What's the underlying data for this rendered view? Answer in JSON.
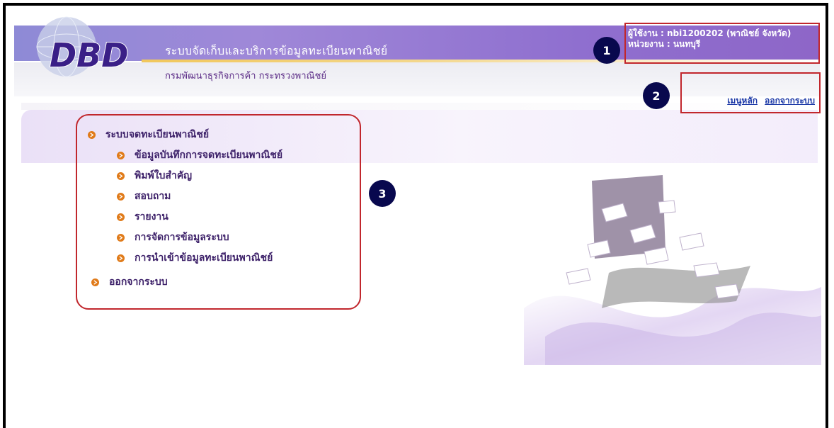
{
  "header": {
    "logo_text": "DBD",
    "system_title": "ระบบจัดเก็บและบริการข้อมูลทะเบียนพาณิชย์",
    "department": "กรมพัฒนาธุรกิจการค้า  กระทรวงพาณิชย์"
  },
  "user": {
    "user_line": "ผู้ใช้งาน : nbi1200202 (พาณิชย์ จังหวัด)",
    "unit_line": "หน่วยงาน : นนทบุรี"
  },
  "nav": {
    "main_menu": "เมนูหลัก",
    "logout": "ออกจากระบบ"
  },
  "badges": {
    "b1": "1",
    "b2": "2",
    "b3": "3"
  },
  "menu": {
    "registration": "ระบบจดทะเบียนพาณิชย์",
    "items": [
      "ข้อมูลบันทึกการจดทะเบียนพาณิชย์",
      "พิมพ์ใบสำคัญ",
      "สอบถาม",
      "รายงาน",
      "การจัดการข้อมูลระบบ",
      "การนำเข้าข้อมูลทะเบียนพาณิชย์"
    ],
    "logout": "ออกจากระบบ"
  },
  "colors": {
    "banner": "#8f7ad4",
    "highlight_box": "#c1272d",
    "badge": "#08084e",
    "menu_text": "#3e226a",
    "bullet": "#e07b1a",
    "link": "#1a37a6"
  }
}
